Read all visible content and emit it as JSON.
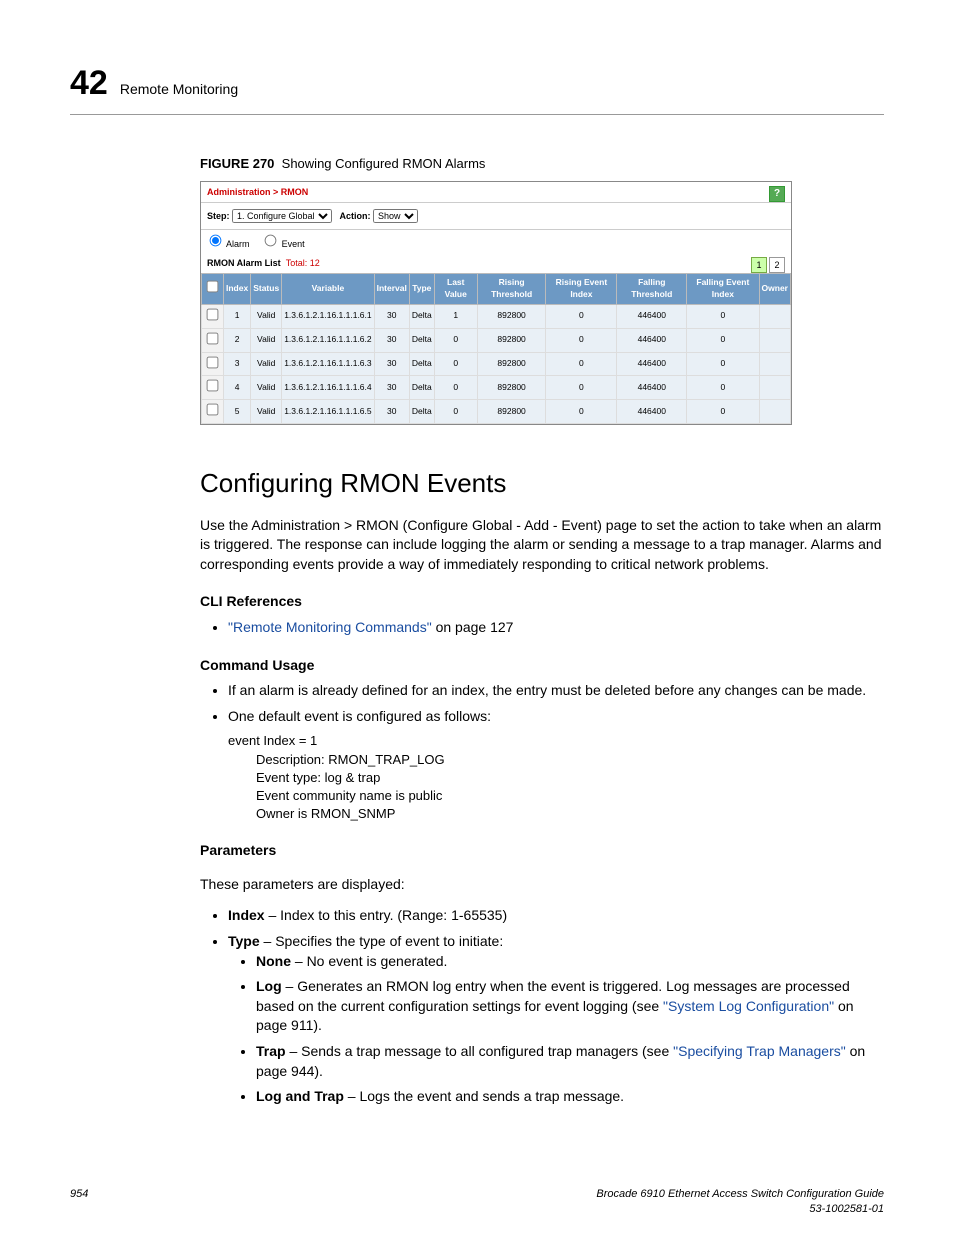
{
  "header": {
    "chapter": "42",
    "title": "Remote Monitoring"
  },
  "figure": {
    "label": "FIGURE 270",
    "caption": "Showing Configured RMON Alarms"
  },
  "screenshot": {
    "breadcrumb": "Administration > RMON",
    "step_label": "Step:",
    "step_value": "1. Configure Global",
    "action_label": "Action:",
    "action_value": "Show",
    "radio_alarm": "Alarm",
    "radio_event": "Event",
    "list_title": "RMON Alarm List",
    "list_total_label": "Total:",
    "list_total": "12",
    "help": "?",
    "pager": [
      "1",
      "2"
    ],
    "columns": [
      "",
      "Index",
      "Status",
      "Variable",
      "Interval",
      "Type",
      "Last Value",
      "Rising Threshold",
      "Rising Event Index",
      "Falling Threshold",
      "Falling Event Index",
      "Owner"
    ],
    "rows": [
      [
        "1",
        "Valid",
        "1.3.6.1.2.1.16.1.1.1.6.1",
        "30",
        "Delta",
        "1",
        "892800",
        "0",
        "446400",
        "0",
        ""
      ],
      [
        "2",
        "Valid",
        "1.3.6.1.2.1.16.1.1.1.6.2",
        "30",
        "Delta",
        "0",
        "892800",
        "0",
        "446400",
        "0",
        ""
      ],
      [
        "3",
        "Valid",
        "1.3.6.1.2.1.16.1.1.1.6.3",
        "30",
        "Delta",
        "0",
        "892800",
        "0",
        "446400",
        "0",
        ""
      ],
      [
        "4",
        "Valid",
        "1.3.6.1.2.1.16.1.1.1.6.4",
        "30",
        "Delta",
        "0",
        "892800",
        "0",
        "446400",
        "0",
        ""
      ],
      [
        "5",
        "Valid",
        "1.3.6.1.2.1.16.1.1.1.6.5",
        "30",
        "Delta",
        "0",
        "892800",
        "0",
        "446400",
        "0",
        ""
      ]
    ]
  },
  "section_title": "Configuring RMON Events",
  "intro": "Use the Administration > RMON (Configure Global - Add - Event) page to set the action to take when an alarm is triggered. The response can include logging the alarm or sending a message to a trap manager. Alarms and corresponding events provide a way of immediately responding to critical network problems.",
  "cli_ref_head": "CLI References",
  "cli_ref_link": "\"Remote Monitoring Commands\"",
  "cli_ref_tail": " on page 127",
  "cmd_usage_head": "Command Usage",
  "cmd_usage_1": "If an alarm is already defined for an index, the entry must be deleted before any changes can be made.",
  "cmd_usage_2": "One default event is configured as follows:",
  "code": {
    "l1": "event Index = 1",
    "l2": "Description: RMON_TRAP_LOG",
    "l3": "Event type: log & trap",
    "l4": "Event community name is public",
    "l5": "Owner is RMON_SNMP"
  },
  "params_head": "Parameters",
  "params_intro": "These parameters are displayed:",
  "p_index_b": "Index",
  "p_index_t": " – Index to this entry. (Range: 1-65535)",
  "p_type_b": "Type",
  "p_type_t": " – Specifies the type of event to initiate:",
  "p_none_b": "None",
  "p_none_t": " – No event is generated.",
  "p_log_b": "Log",
  "p_log_t1": " – Generates an RMON log entry when the event is triggered. Log messages are processed based on the current configuration settings for event logging (see ",
  "p_log_link": "\"System Log Configuration\"",
  "p_log_t2": " on page 911).",
  "p_trap_b": "Trap",
  "p_trap_t1": " – Sends a trap message to all configured trap managers (see ",
  "p_trap_link": "\"Specifying Trap Managers\"",
  "p_trap_t2": " on page 944).",
  "p_lat_b": "Log and Trap",
  "p_lat_t": " – Logs the event and sends a trap message.",
  "footer": {
    "page": "954",
    "title": "Brocade 6910 Ethernet Access Switch Configuration Guide",
    "doc": "53-1002581-01"
  }
}
